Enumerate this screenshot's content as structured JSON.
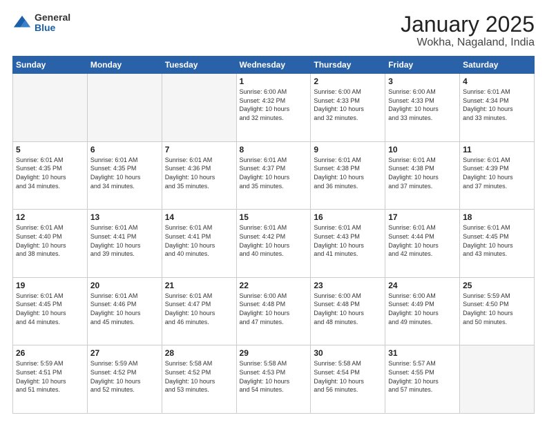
{
  "logo": {
    "general": "General",
    "blue": "Blue"
  },
  "header": {
    "month": "January 2025",
    "location": "Wokha, Nagaland, India"
  },
  "days_of_week": [
    "Sunday",
    "Monday",
    "Tuesday",
    "Wednesday",
    "Thursday",
    "Friday",
    "Saturday"
  ],
  "weeks": [
    [
      {
        "day": "",
        "info": ""
      },
      {
        "day": "",
        "info": ""
      },
      {
        "day": "",
        "info": ""
      },
      {
        "day": "1",
        "info": "Sunrise: 6:00 AM\nSunset: 4:32 PM\nDaylight: 10 hours\nand 32 minutes."
      },
      {
        "day": "2",
        "info": "Sunrise: 6:00 AM\nSunset: 4:33 PM\nDaylight: 10 hours\nand 32 minutes."
      },
      {
        "day": "3",
        "info": "Sunrise: 6:00 AM\nSunset: 4:33 PM\nDaylight: 10 hours\nand 33 minutes."
      },
      {
        "day": "4",
        "info": "Sunrise: 6:01 AM\nSunset: 4:34 PM\nDaylight: 10 hours\nand 33 minutes."
      }
    ],
    [
      {
        "day": "5",
        "info": "Sunrise: 6:01 AM\nSunset: 4:35 PM\nDaylight: 10 hours\nand 34 minutes."
      },
      {
        "day": "6",
        "info": "Sunrise: 6:01 AM\nSunset: 4:35 PM\nDaylight: 10 hours\nand 34 minutes."
      },
      {
        "day": "7",
        "info": "Sunrise: 6:01 AM\nSunset: 4:36 PM\nDaylight: 10 hours\nand 35 minutes."
      },
      {
        "day": "8",
        "info": "Sunrise: 6:01 AM\nSunset: 4:37 PM\nDaylight: 10 hours\nand 35 minutes."
      },
      {
        "day": "9",
        "info": "Sunrise: 6:01 AM\nSunset: 4:38 PM\nDaylight: 10 hours\nand 36 minutes."
      },
      {
        "day": "10",
        "info": "Sunrise: 6:01 AM\nSunset: 4:38 PM\nDaylight: 10 hours\nand 37 minutes."
      },
      {
        "day": "11",
        "info": "Sunrise: 6:01 AM\nSunset: 4:39 PM\nDaylight: 10 hours\nand 37 minutes."
      }
    ],
    [
      {
        "day": "12",
        "info": "Sunrise: 6:01 AM\nSunset: 4:40 PM\nDaylight: 10 hours\nand 38 minutes."
      },
      {
        "day": "13",
        "info": "Sunrise: 6:01 AM\nSunset: 4:41 PM\nDaylight: 10 hours\nand 39 minutes."
      },
      {
        "day": "14",
        "info": "Sunrise: 6:01 AM\nSunset: 4:41 PM\nDaylight: 10 hours\nand 40 minutes."
      },
      {
        "day": "15",
        "info": "Sunrise: 6:01 AM\nSunset: 4:42 PM\nDaylight: 10 hours\nand 40 minutes."
      },
      {
        "day": "16",
        "info": "Sunrise: 6:01 AM\nSunset: 4:43 PM\nDaylight: 10 hours\nand 41 minutes."
      },
      {
        "day": "17",
        "info": "Sunrise: 6:01 AM\nSunset: 4:44 PM\nDaylight: 10 hours\nand 42 minutes."
      },
      {
        "day": "18",
        "info": "Sunrise: 6:01 AM\nSunset: 4:45 PM\nDaylight: 10 hours\nand 43 minutes."
      }
    ],
    [
      {
        "day": "19",
        "info": "Sunrise: 6:01 AM\nSunset: 4:45 PM\nDaylight: 10 hours\nand 44 minutes."
      },
      {
        "day": "20",
        "info": "Sunrise: 6:01 AM\nSunset: 4:46 PM\nDaylight: 10 hours\nand 45 minutes."
      },
      {
        "day": "21",
        "info": "Sunrise: 6:01 AM\nSunset: 4:47 PM\nDaylight: 10 hours\nand 46 minutes."
      },
      {
        "day": "22",
        "info": "Sunrise: 6:00 AM\nSunset: 4:48 PM\nDaylight: 10 hours\nand 47 minutes."
      },
      {
        "day": "23",
        "info": "Sunrise: 6:00 AM\nSunset: 4:48 PM\nDaylight: 10 hours\nand 48 minutes."
      },
      {
        "day": "24",
        "info": "Sunrise: 6:00 AM\nSunset: 4:49 PM\nDaylight: 10 hours\nand 49 minutes."
      },
      {
        "day": "25",
        "info": "Sunrise: 5:59 AM\nSunset: 4:50 PM\nDaylight: 10 hours\nand 50 minutes."
      }
    ],
    [
      {
        "day": "26",
        "info": "Sunrise: 5:59 AM\nSunset: 4:51 PM\nDaylight: 10 hours\nand 51 minutes."
      },
      {
        "day": "27",
        "info": "Sunrise: 5:59 AM\nSunset: 4:52 PM\nDaylight: 10 hours\nand 52 minutes."
      },
      {
        "day": "28",
        "info": "Sunrise: 5:58 AM\nSunset: 4:52 PM\nDaylight: 10 hours\nand 53 minutes."
      },
      {
        "day": "29",
        "info": "Sunrise: 5:58 AM\nSunset: 4:53 PM\nDaylight: 10 hours\nand 54 minutes."
      },
      {
        "day": "30",
        "info": "Sunrise: 5:58 AM\nSunset: 4:54 PM\nDaylight: 10 hours\nand 56 minutes."
      },
      {
        "day": "31",
        "info": "Sunrise: 5:57 AM\nSunset: 4:55 PM\nDaylight: 10 hours\nand 57 minutes."
      },
      {
        "day": "",
        "info": ""
      }
    ]
  ]
}
